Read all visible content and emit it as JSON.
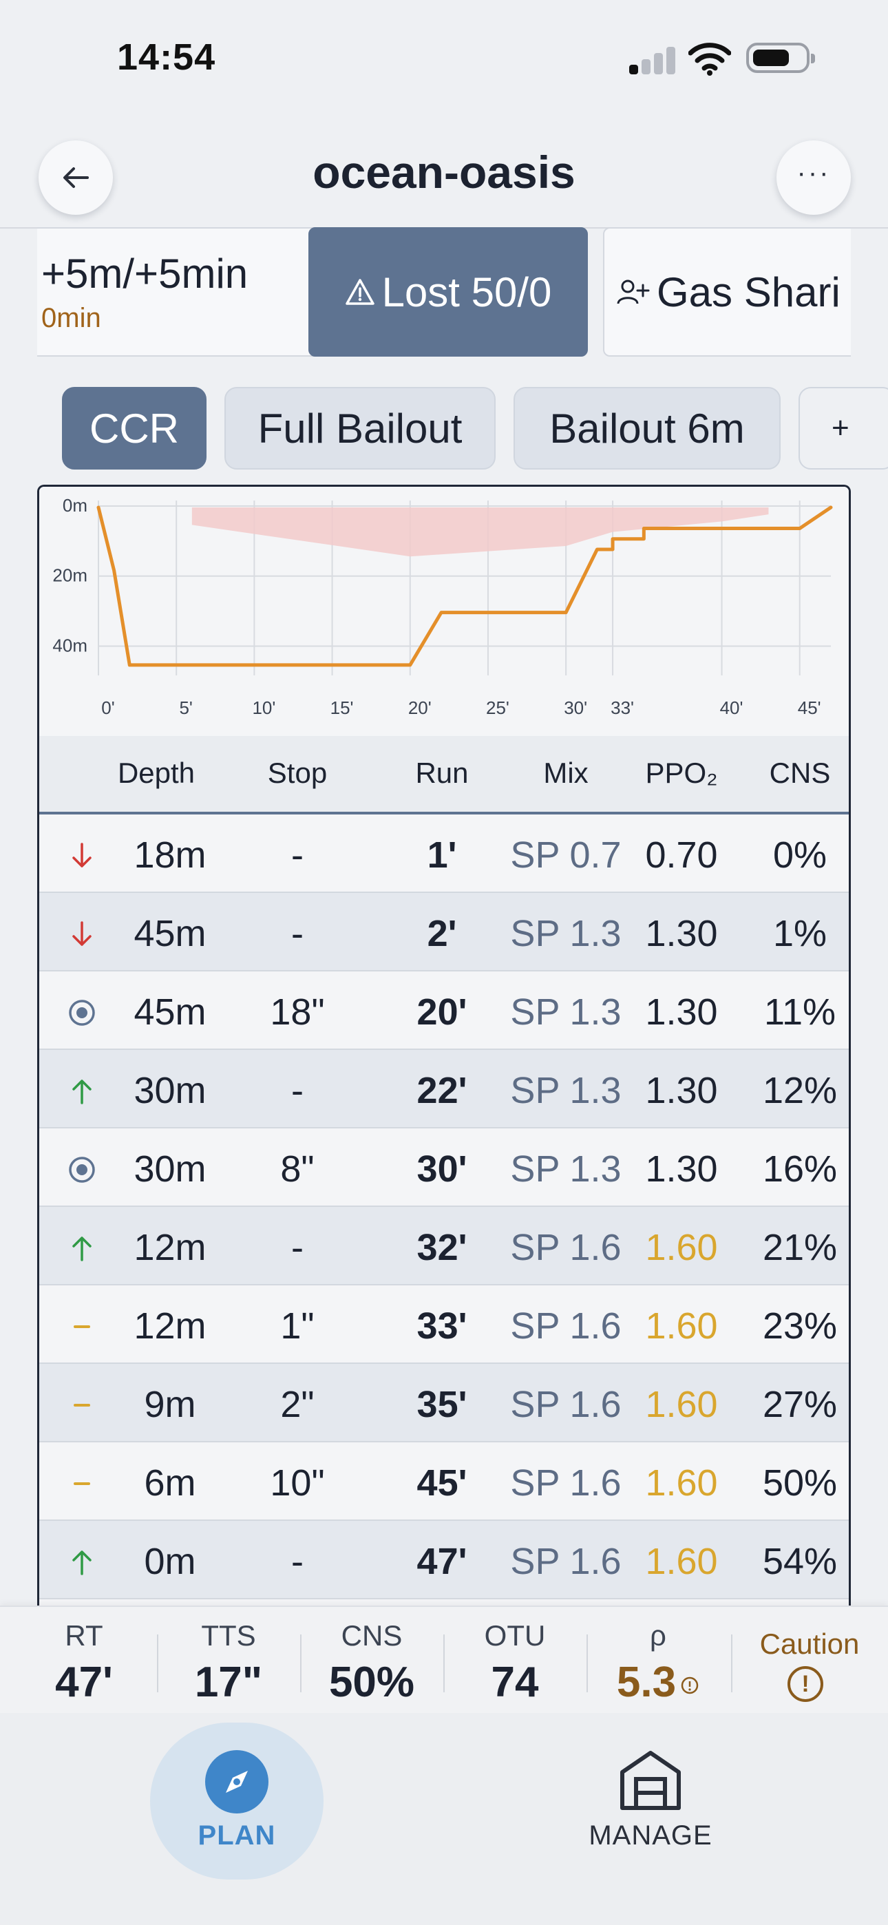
{
  "status_bar": {
    "time": "14:54"
  },
  "header": {
    "title": "ocean-oasis",
    "back_icon": "arrow-left-icon",
    "more_icon": "ellipsis-icon"
  },
  "scenarios": [
    {
      "label": "+5m/+5min",
      "sub": "0min",
      "active": false
    },
    {
      "label": "Lost 50/0",
      "icon": "warning-triangle-icon",
      "active": true
    },
    {
      "label": "Gas Shari",
      "icon": "user-plus-icon",
      "active": false
    }
  ],
  "modes": [
    {
      "label": "CCR",
      "active": true
    },
    {
      "label": "Full Bailout",
      "active": false
    },
    {
      "label": "Bailout 6m",
      "active": false
    },
    {
      "label": "+",
      "active": false
    }
  ],
  "chart_data": {
    "type": "line",
    "y_tick_labels": [
      "0m",
      "20m",
      "40m"
    ],
    "x_tick_labels": [
      "0'",
      "5'",
      "10'",
      "15'",
      "20'",
      "25'",
      "30'",
      "33'",
      "40'",
      "45'"
    ],
    "profile": {
      "x": [
        0,
        1,
        2,
        20,
        22,
        30,
        32,
        33,
        33,
        35,
        35,
        45,
        47
      ],
      "y": [
        0,
        18,
        45,
        45,
        30,
        30,
        12,
        12,
        9,
        9,
        6,
        6,
        0
      ]
    },
    "ceiling_band": {
      "x": [
        6,
        20,
        30,
        33,
        40,
        43
      ],
      "y_top": [
        0,
        0,
        0,
        0,
        0,
        0
      ],
      "y_bottom": [
        5,
        14,
        11,
        7,
        4,
        2
      ]
    },
    "ylim": [
      0,
      46
    ],
    "xlim": [
      0,
      47
    ],
    "colors": {
      "profile": "#e48f2a",
      "ceiling": "#f2caca",
      "grid": "#d8dbe0"
    }
  },
  "table": {
    "headers": [
      "Depth",
      "Stop",
      "Run",
      "Mix",
      "PPO₂",
      "CNS"
    ],
    "rows": [
      {
        "icon": "descent-arrow-icon",
        "depth": "18m",
        "stop": "-",
        "run": "1'",
        "mix": "SP 0.7",
        "ppo2": "0.70",
        "ppo2_warn": false,
        "cns": "0%"
      },
      {
        "icon": "descent-arrow-icon",
        "depth": "45m",
        "stop": "-",
        "run": "2'",
        "mix": "SP 1.3",
        "ppo2": "1.30",
        "ppo2_warn": false,
        "cns": "1%"
      },
      {
        "icon": "bottom-target-icon",
        "depth": "45m",
        "stop": "18\"",
        "run": "20'",
        "mix": "SP 1.3",
        "ppo2": "1.30",
        "ppo2_warn": false,
        "cns": "11%"
      },
      {
        "icon": "ascent-arrow-icon",
        "depth": "30m",
        "stop": "-",
        "run": "22'",
        "mix": "SP 1.3",
        "ppo2": "1.30",
        "ppo2_warn": false,
        "cns": "12%"
      },
      {
        "icon": "bottom-target-icon",
        "depth": "30m",
        "stop": "8\"",
        "run": "30'",
        "mix": "SP 1.3",
        "ppo2": "1.30",
        "ppo2_warn": false,
        "cns": "16%"
      },
      {
        "icon": "ascent-arrow-icon",
        "depth": "12m",
        "stop": "-",
        "run": "32'",
        "mix": "SP 1.6",
        "ppo2": "1.60",
        "ppo2_warn": true,
        "cns": "21%"
      },
      {
        "icon": "deco-stop-dash-icon",
        "depth": "12m",
        "stop": "1\"",
        "run": "33'",
        "mix": "SP 1.6",
        "ppo2": "1.60",
        "ppo2_warn": true,
        "cns": "23%"
      },
      {
        "icon": "deco-stop-dash-icon",
        "depth": "9m",
        "stop": "2\"",
        "run": "35'",
        "mix": "SP 1.6",
        "ppo2": "1.60",
        "ppo2_warn": true,
        "cns": "27%"
      },
      {
        "icon": "deco-stop-dash-icon",
        "depth": "6m",
        "stop": "10\"",
        "run": "45'",
        "mix": "SP 1.6",
        "ppo2": "1.60",
        "ppo2_warn": true,
        "cns": "50%"
      },
      {
        "icon": "ascent-arrow-icon",
        "depth": "0m",
        "stop": "-",
        "run": "47'",
        "mix": "SP 1.6",
        "ppo2": "1.60",
        "ppo2_warn": true,
        "cns": "54%"
      }
    ]
  },
  "summary": {
    "rt": {
      "label": "RT",
      "value": "47'"
    },
    "tts": {
      "label": "TTS",
      "value": "17\""
    },
    "cns": {
      "label": "CNS",
      "value": "50%"
    },
    "otu": {
      "label": "OTU",
      "value": "74"
    },
    "rho": {
      "label": "ρ",
      "value": "5.3"
    },
    "caution": {
      "label": "Caution",
      "icon": "exclamation-circle-icon"
    }
  },
  "bottom_nav": {
    "plan": {
      "label": "PLAN",
      "icon": "compass-icon",
      "active": true
    },
    "manage": {
      "label": "MANAGE",
      "icon": "warehouse-icon",
      "active": false
    }
  }
}
